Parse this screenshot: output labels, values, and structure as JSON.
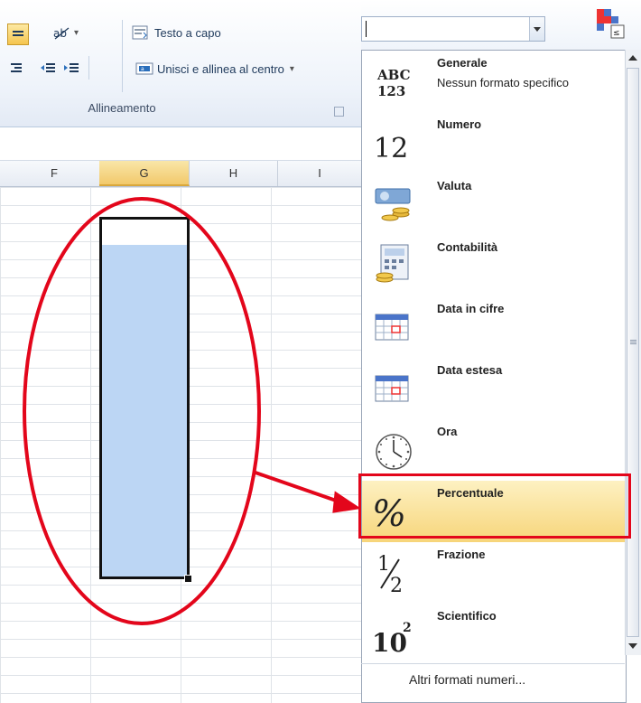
{
  "ribbon": {
    "wrap_text_label": "Testo a capo",
    "merge_center_label": "Unisci e allinea al centro",
    "merge_dropdown_glyph": "▾",
    "orientation_dropdown_glyph": "▾",
    "group_label": "Allineamento"
  },
  "number_format": {
    "current_value": "",
    "menu_items": [
      {
        "label": "Generale",
        "sublabel": "Nessun formato specifico",
        "icon": "abc-123-icon"
      },
      {
        "label": "Numero",
        "sublabel": "",
        "icon": "number-12-icon"
      },
      {
        "label": "Valuta",
        "sublabel": "",
        "icon": "currency-icon"
      },
      {
        "label": "Contabilità",
        "sublabel": "",
        "icon": "accounting-icon"
      },
      {
        "label": "Data in cifre",
        "sublabel": "",
        "icon": "short-date-icon"
      },
      {
        "label": "Data estesa",
        "sublabel": "",
        "icon": "long-date-icon"
      },
      {
        "label": "Ora",
        "sublabel": "",
        "icon": "clock-icon"
      },
      {
        "label": "Percentuale",
        "sublabel": "",
        "icon": "percent-icon",
        "highlighted": true
      },
      {
        "label": "Frazione",
        "sublabel": "",
        "icon": "fraction-icon"
      },
      {
        "label": "Scientifico",
        "sublabel": "",
        "icon": "scientific-icon"
      }
    ],
    "more_formats": "Altri formati numeri..."
  },
  "icons": {
    "abc_top": "ABC",
    "abc_bottom": "123",
    "number": "12",
    "percent": "%",
    "fraction_num": "1",
    "fraction_den": "2",
    "sci_base": "10",
    "sci_exp": "2"
  },
  "sheet": {
    "columns": [
      "F",
      "G",
      "H",
      "I"
    ],
    "selected_column": "G"
  },
  "colors": {
    "accent_highlight": "#f7d57a",
    "annotation_red": "#e3061b",
    "selection_fill": "#bcd6f4"
  }
}
